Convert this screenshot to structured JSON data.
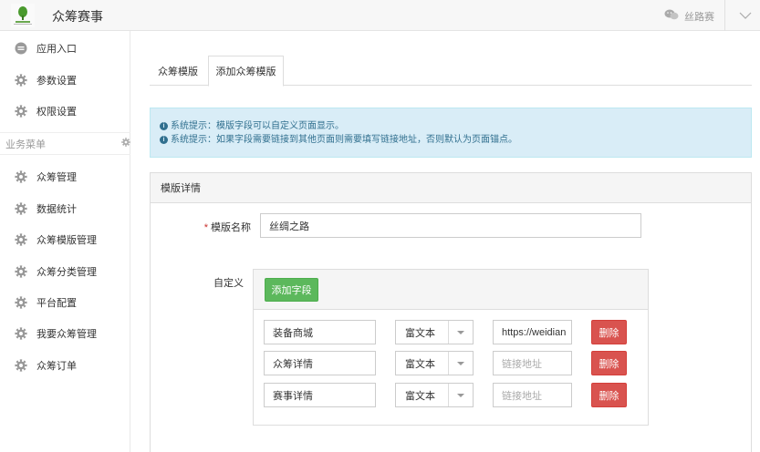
{
  "header": {
    "app_title": "众筹赛事",
    "user_name": "丝路赛",
    "icons": {
      "logo": "leaf-logo",
      "user": "user-icon",
      "menu": "chevron-down-icon"
    }
  },
  "sidebar": {
    "top_items": [
      {
        "label": "应用入口",
        "icon": "chat-icon"
      },
      {
        "label": "参数设置",
        "icon": "gear-icon"
      },
      {
        "label": "权限设置",
        "icon": "gear-icon"
      }
    ],
    "section_title": "业务菜单",
    "business_items": [
      {
        "label": "众筹管理",
        "icon": "gear-icon"
      },
      {
        "label": "数据统计",
        "icon": "gear-icon"
      },
      {
        "label": "众筹模版管理",
        "icon": "gear-icon"
      },
      {
        "label": "众筹分类管理",
        "icon": "gear-icon"
      },
      {
        "label": "平台配置",
        "icon": "gear-icon"
      },
      {
        "label": "我要众筹管理",
        "icon": "gear-icon"
      },
      {
        "label": "众筹订单",
        "icon": "gear-icon"
      }
    ]
  },
  "tabs": [
    {
      "label": "众筹模版",
      "active": false
    },
    {
      "label": "添加众筹模版",
      "active": true
    }
  ],
  "alert": {
    "lines": [
      "系统提示：模版字段可以自定义页面显示。",
      "系统提示：如果字段需要链接到其他页面则需要填写链接地址，否则默认为页面锚点。"
    ],
    "icon": "info-circle-icon"
  },
  "panel": {
    "title": "模版详情",
    "name_label": "模版名称",
    "name_required_mark": "*",
    "name_value": "丝绸之路",
    "custom_label": "自定义",
    "add_field_button": "添加字段",
    "fields": [
      {
        "name": "装备商城",
        "type": "富文本",
        "link_value": "https://weidian",
        "link_placeholder": "链接地址",
        "delete_label": "删除"
      },
      {
        "name": "众筹详情",
        "type": "富文本",
        "link_value": "",
        "link_placeholder": "链接地址",
        "delete_label": "删除"
      },
      {
        "name": "赛事详情",
        "type": "富文本",
        "link_value": "",
        "link_placeholder": "链接地址",
        "delete_label": "删除"
      }
    ]
  },
  "colors": {
    "primary_green": "#5cb85c",
    "danger_red": "#d9534f",
    "info_bg": "#d9edf7",
    "info_text": "#31708f"
  }
}
